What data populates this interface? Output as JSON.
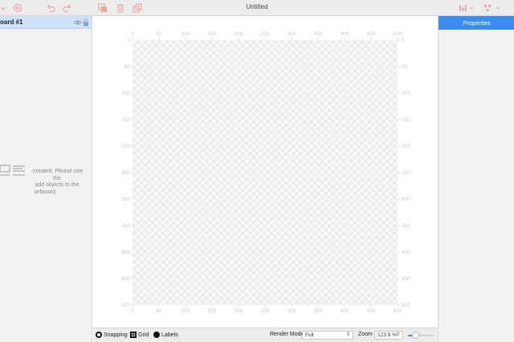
{
  "window": {
    "title": "Untitled"
  },
  "toolbar": {
    "icons": [
      "target-icon",
      "undo-icon",
      "redo-icon",
      "duplicate-icon",
      "trash-icon",
      "arrange-icon",
      "align-icon",
      "distribute-icon"
    ]
  },
  "layers": {
    "artboard_name": "oard #1",
    "empty_message_lines": [
      "-created. Please use the",
      "add objects to the",
      "artboard."
    ]
  },
  "properties": {
    "tab_label": "Properties"
  },
  "canvas": {
    "ruler_labels": [
      "0",
      "50",
      "100",
      "150",
      "200",
      "250",
      "300",
      "350",
      "400",
      "450",
      "500"
    ]
  },
  "statusbar": {
    "snapping_label": "Snapping",
    "grid_label": "Grid",
    "labels_label": "Labels",
    "render_mode_label": "Render Mode",
    "render_mode_value": "Full",
    "zoom_label": "Zoom",
    "zoom_value": "123.9 %"
  },
  "colors": {
    "accent": "#3b8df2",
    "toolbar_icon": "#f0a6a0",
    "selected_row": "#cfe2fb"
  }
}
